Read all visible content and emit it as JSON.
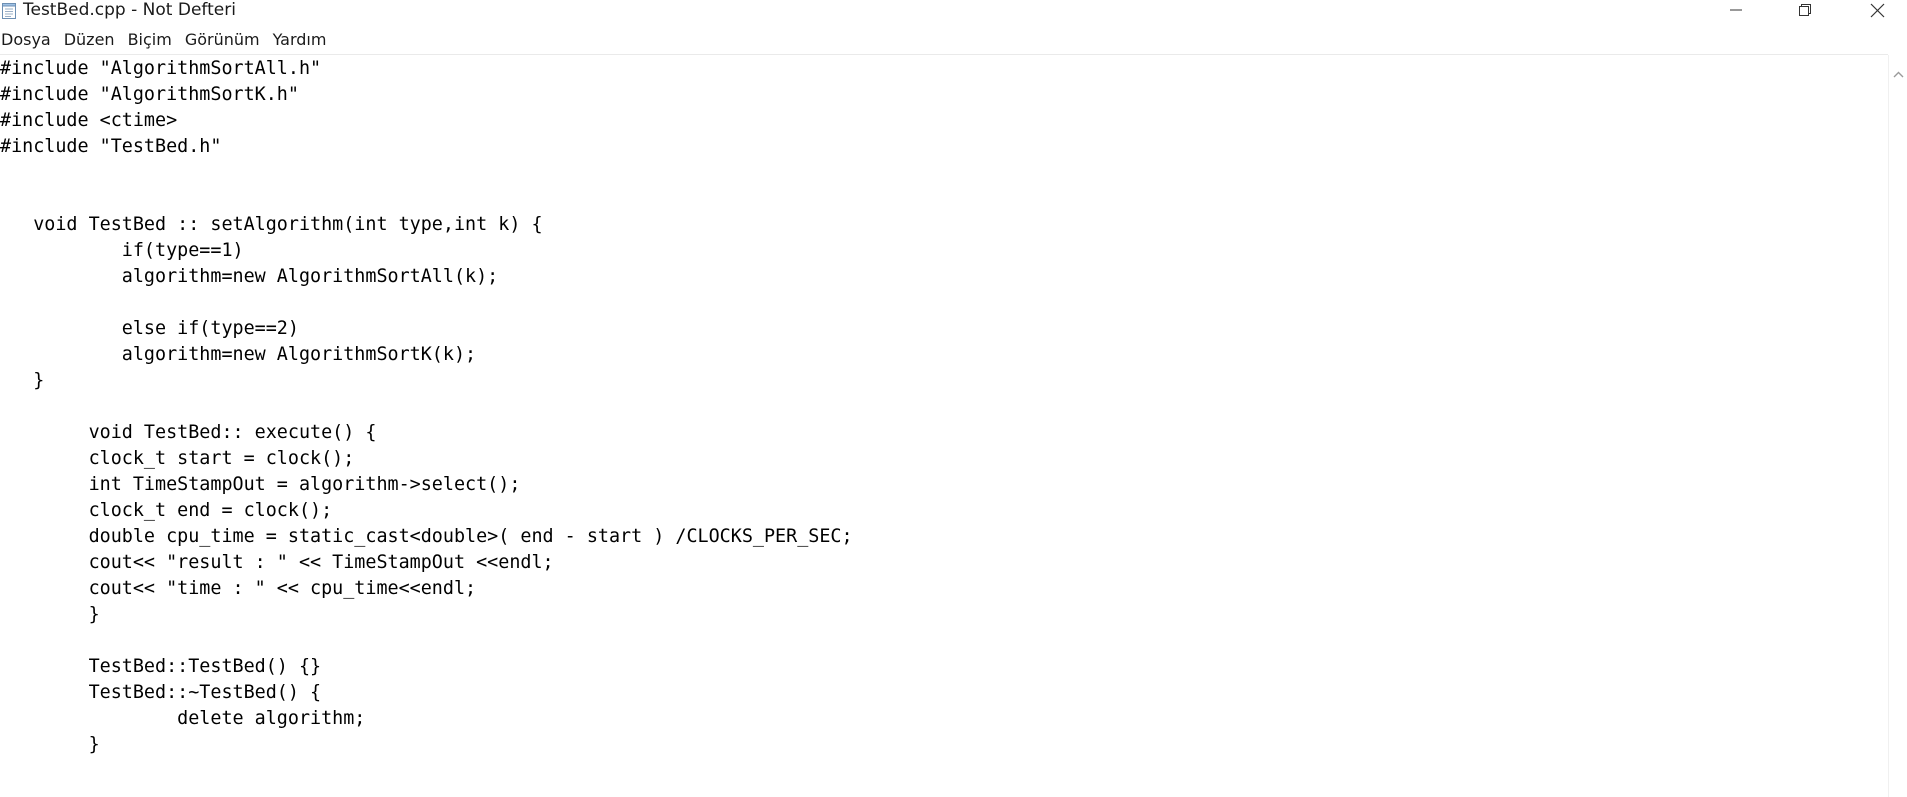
{
  "window": {
    "title": "TestBed.cpp - Not Defteri"
  },
  "menu": {
    "items": [
      "Dosya",
      "Düzen",
      "Biçim",
      "Görünüm",
      "Yardım"
    ]
  },
  "editor": {
    "lines": [
      "#include \"AlgorithmSortAll.h\"",
      "#include \"AlgorithmSortK.h\"",
      "#include <ctime>",
      "#include \"TestBed.h\"",
      "",
      "",
      "   void TestBed :: setAlgorithm(int type,int k) {",
      "           if(type==1)",
      "           algorithm=new AlgorithmSortAll(k);",
      "",
      "           else if(type==2)",
      "           algorithm=new AlgorithmSortK(k);",
      "   }",
      "",
      "        void TestBed:: execute() {",
      "        clock_t start = clock();",
      "        int TimeStampOut = algorithm->select();",
      "        clock_t end = clock();",
      "        double cpu_time = static_cast<double>( end - start ) /CLOCKS_PER_SEC;",
      "        cout<< \"result : \" << TimeStampOut <<endl;",
      "        cout<< \"time : \" << cpu_time<<endl;",
      "        }",
      "",
      "        TestBed::TestBed() {}",
      "        TestBed::~TestBed() {",
      "                delete algorithm;",
      "        }"
    ]
  },
  "icons": {
    "app": "notepad-icon",
    "minimize": "minimize-icon",
    "restore": "restore-icon",
    "close": "close-icon",
    "scroll_up": "chevron-up-icon"
  },
  "colors": {
    "text": "#000000",
    "background": "#ffffff"
  }
}
